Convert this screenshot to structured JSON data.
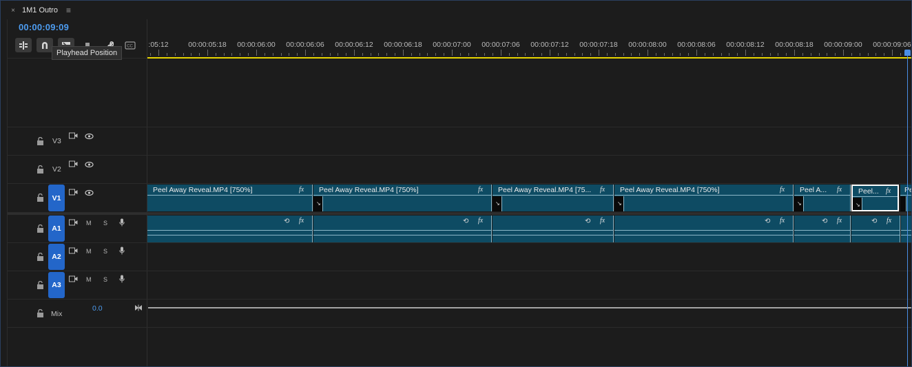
{
  "panel": {
    "tab_title": "1M1 Outro",
    "close_glyph": "×",
    "menu_glyph": "≡"
  },
  "timecode": "00:00:09:09",
  "toolbar": {
    "tooltip": "Playhead Position",
    "icons": [
      "insert-sequence-icon",
      "snap-magnet-icon",
      "linked-selection-icon",
      "add-marker-icon",
      "wrench-icon",
      "captions-icon"
    ]
  },
  "ruler": {
    "labels": [
      ":05:12",
      "00:00:05:18",
      "00:00:06:00",
      "00:00:06:06",
      "00:00:06:12",
      "00:00:06:18",
      "00:00:07:00",
      "00:00:07:06",
      "00:00:07:12",
      "00:00:07:18",
      "00:00:08:00",
      "00:00:08:06",
      "00:00:08:12",
      "00:00:08:18",
      "00:00:09:00",
      "00:00:09:06"
    ]
  },
  "tracks": {
    "v3": {
      "name": "V3"
    },
    "v2": {
      "name": "V2"
    },
    "v1": {
      "name": "V1"
    },
    "a1": {
      "name": "A1",
      "m": "M",
      "s": "S"
    },
    "a2": {
      "name": "A2",
      "m": "M",
      "s": "S"
    },
    "a3": {
      "name": "A3",
      "m": "M",
      "s": "S"
    },
    "mix": {
      "name": "Mix",
      "value": "0.0"
    }
  },
  "clips": {
    "fx": "fx",
    "c1": "Peel Away Reveal.MP4 [750%]",
    "c2": "Peel Away Reveal.MP4 [750%]",
    "c3": "Peel Away Reveal.MP4 [75...",
    "c4": "Peel Away Reveal.MP4 [750%]",
    "c5": "Peel A...",
    "c6": "Peel...",
    "c7": "Pe"
  },
  "colors": {
    "accent": "#4d9cf0",
    "clip": "#0e4b63",
    "target": "#2366c9",
    "work_area": "#e8d600"
  }
}
